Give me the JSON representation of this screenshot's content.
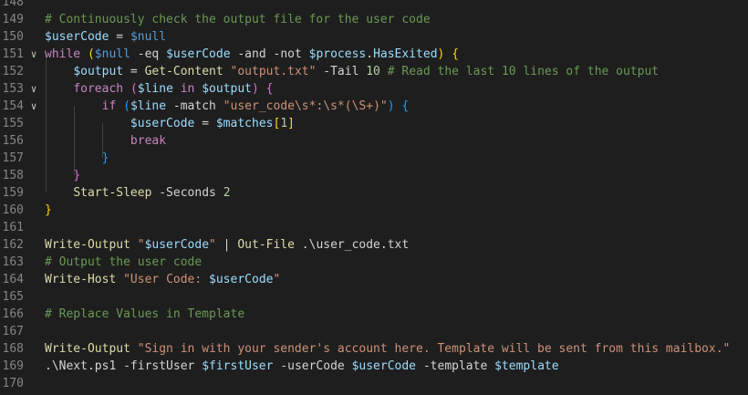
{
  "editor": {
    "language": "powershell",
    "colors": {
      "background": "#1e1e1e",
      "line_number": "#858585",
      "comment": "#6a9955",
      "variable": "#9cdcfe",
      "keyword": "#c586c0",
      "cmdlet": "#dcdcaa",
      "string": "#ce9178",
      "number": "#b5cea8"
    },
    "lines": [
      {
        "num": "148",
        "fold": false,
        "tokens": []
      },
      {
        "num": "149",
        "fold": false,
        "tokens": [
          {
            "t": "# Continuously check the output file for the user code",
            "c": "comment"
          }
        ]
      },
      {
        "num": "150",
        "fold": false,
        "tokens": [
          {
            "t": "$userCode",
            "c": "var"
          },
          {
            "t": " = ",
            "c": "op"
          },
          {
            "t": "$null",
            "c": "ctl"
          }
        ]
      },
      {
        "num": "151",
        "fold": true,
        "tokens": [
          {
            "t": "while",
            "c": "kw"
          },
          {
            "t": " ",
            "c": "op"
          },
          {
            "t": "(",
            "c": "brk1"
          },
          {
            "t": "$null",
            "c": "ctl"
          },
          {
            "t": " -eq ",
            "c": "op"
          },
          {
            "t": "$userCode",
            "c": "var"
          },
          {
            "t": " -and -not ",
            "c": "op"
          },
          {
            "t": "$process",
            "c": "var"
          },
          {
            "t": ".",
            "c": "op"
          },
          {
            "t": "HasExited",
            "c": "var"
          },
          {
            "t": ")",
            "c": "brk1"
          },
          {
            "t": " ",
            "c": "op"
          },
          {
            "t": "{",
            "c": "brk1"
          }
        ]
      },
      {
        "num": "152",
        "fold": false,
        "tokens": [
          {
            "t": "    ",
            "c": "op"
          },
          {
            "t": "$output",
            "c": "var"
          },
          {
            "t": " = ",
            "c": "op"
          },
          {
            "t": "Get-Content",
            "c": "cmd"
          },
          {
            "t": " ",
            "c": "op"
          },
          {
            "t": "\"output.txt\"",
            "c": "str"
          },
          {
            "t": " -Tail ",
            "c": "op"
          },
          {
            "t": "10",
            "c": "num"
          },
          {
            "t": " ",
            "c": "op"
          },
          {
            "t": "# Read the last 10 lines of the output",
            "c": "comment"
          }
        ]
      },
      {
        "num": "153",
        "fold": true,
        "tokens": [
          {
            "t": "    ",
            "c": "op"
          },
          {
            "t": "foreach",
            "c": "kw"
          },
          {
            "t": " ",
            "c": "op"
          },
          {
            "t": "(",
            "c": "brk2"
          },
          {
            "t": "$line",
            "c": "var"
          },
          {
            "t": " in ",
            "c": "kw"
          },
          {
            "t": "$output",
            "c": "var"
          },
          {
            "t": ")",
            "c": "brk2"
          },
          {
            "t": " ",
            "c": "op"
          },
          {
            "t": "{",
            "c": "brk2"
          }
        ]
      },
      {
        "num": "154",
        "fold": true,
        "tokens": [
          {
            "t": "        ",
            "c": "op"
          },
          {
            "t": "if",
            "c": "kw"
          },
          {
            "t": " ",
            "c": "op"
          },
          {
            "t": "(",
            "c": "brk3"
          },
          {
            "t": "$line",
            "c": "var"
          },
          {
            "t": " -match ",
            "c": "op"
          },
          {
            "t": "\"user_code\\s*:\\s*(\\S+)\"",
            "c": "str"
          },
          {
            "t": ")",
            "c": "brk3"
          },
          {
            "t": " ",
            "c": "op"
          },
          {
            "t": "{",
            "c": "brk3"
          }
        ]
      },
      {
        "num": "155",
        "fold": false,
        "tokens": [
          {
            "t": "            ",
            "c": "op"
          },
          {
            "t": "$userCode",
            "c": "var"
          },
          {
            "t": " = ",
            "c": "op"
          },
          {
            "t": "$matches",
            "c": "var"
          },
          {
            "t": "[",
            "c": "brk1"
          },
          {
            "t": "1",
            "c": "num"
          },
          {
            "t": "]",
            "c": "brk1"
          }
        ]
      },
      {
        "num": "156",
        "fold": false,
        "tokens": [
          {
            "t": "            ",
            "c": "op"
          },
          {
            "t": "break",
            "c": "kw"
          }
        ]
      },
      {
        "num": "157",
        "fold": false,
        "tokens": [
          {
            "t": "        ",
            "c": "op"
          },
          {
            "t": "}",
            "c": "brk3"
          }
        ]
      },
      {
        "num": "158",
        "fold": false,
        "tokens": [
          {
            "t": "    ",
            "c": "op"
          },
          {
            "t": "}",
            "c": "brk2"
          }
        ]
      },
      {
        "num": "159",
        "fold": false,
        "tokens": [
          {
            "t": "    ",
            "c": "op"
          },
          {
            "t": "Start-Sleep",
            "c": "cmd"
          },
          {
            "t": " -Seconds ",
            "c": "op"
          },
          {
            "t": "2",
            "c": "num"
          }
        ]
      },
      {
        "num": "160",
        "fold": false,
        "tokens": [
          {
            "t": "}",
            "c": "brk1"
          }
        ]
      },
      {
        "num": "161",
        "fold": false,
        "tokens": []
      },
      {
        "num": "162",
        "fold": false,
        "tokens": [
          {
            "t": "Write-Output",
            "c": "cmd"
          },
          {
            "t": " ",
            "c": "op"
          },
          {
            "t": "\"",
            "c": "str"
          },
          {
            "t": "$userCode",
            "c": "var"
          },
          {
            "t": "\"",
            "c": "str"
          },
          {
            "t": " | ",
            "c": "op"
          },
          {
            "t": "Out-File",
            "c": "cmd"
          },
          {
            "t": " .\\user_code.txt",
            "c": "op"
          }
        ]
      },
      {
        "num": "163",
        "fold": false,
        "tokens": [
          {
            "t": "# Output the user code",
            "c": "comment"
          }
        ]
      },
      {
        "num": "164",
        "fold": false,
        "tokens": [
          {
            "t": "Write-Host",
            "c": "cmd"
          },
          {
            "t": " ",
            "c": "op"
          },
          {
            "t": "\"User Code: ",
            "c": "str"
          },
          {
            "t": "$userCode",
            "c": "var"
          },
          {
            "t": "\"",
            "c": "str"
          }
        ]
      },
      {
        "num": "165",
        "fold": false,
        "tokens": []
      },
      {
        "num": "166",
        "fold": false,
        "tokens": [
          {
            "t": "# Replace Values in Template",
            "c": "comment"
          }
        ]
      },
      {
        "num": "167",
        "fold": false,
        "tokens": []
      },
      {
        "num": "168",
        "fold": false,
        "tokens": [
          {
            "t": "Write-Output",
            "c": "cmd"
          },
          {
            "t": " ",
            "c": "op"
          },
          {
            "t": "\"Sign in with your sender's account here. Template will be sent from this mailbox.\"",
            "c": "str"
          }
        ]
      },
      {
        "num": "169",
        "fold": false,
        "tokens": [
          {
            "t": ".\\Next.ps1 -firstUser ",
            "c": "op"
          },
          {
            "t": "$firstUser",
            "c": "var"
          },
          {
            "t": " -userCode ",
            "c": "op"
          },
          {
            "t": "$userCode",
            "c": "var"
          },
          {
            "t": " -template ",
            "c": "op"
          },
          {
            "t": "$template",
            "c": "var"
          }
        ]
      },
      {
        "num": "170",
        "fold": false,
        "tokens": []
      }
    ]
  }
}
